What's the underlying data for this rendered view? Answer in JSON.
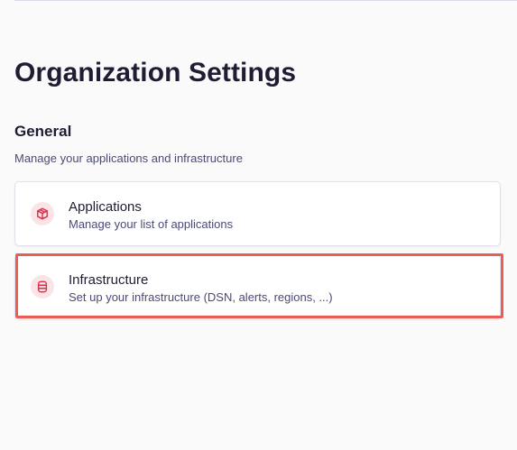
{
  "page": {
    "title": "Organization Settings"
  },
  "section": {
    "title": "General",
    "description": "Manage your applications and infrastructure"
  },
  "cards": [
    {
      "title": "Applications",
      "description": "Manage your list of applications",
      "icon": "cube-icon"
    },
    {
      "title": "Infrastructure",
      "description": "Set up your infrastructure (DSN, alerts, regions, ...)",
      "icon": "database-icon"
    }
  ],
  "colors": {
    "icon_accent": "#d8304a",
    "icon_background": "#fbe3e6",
    "highlight_border": "#ec5e54",
    "muted_text": "#4a4a78"
  }
}
